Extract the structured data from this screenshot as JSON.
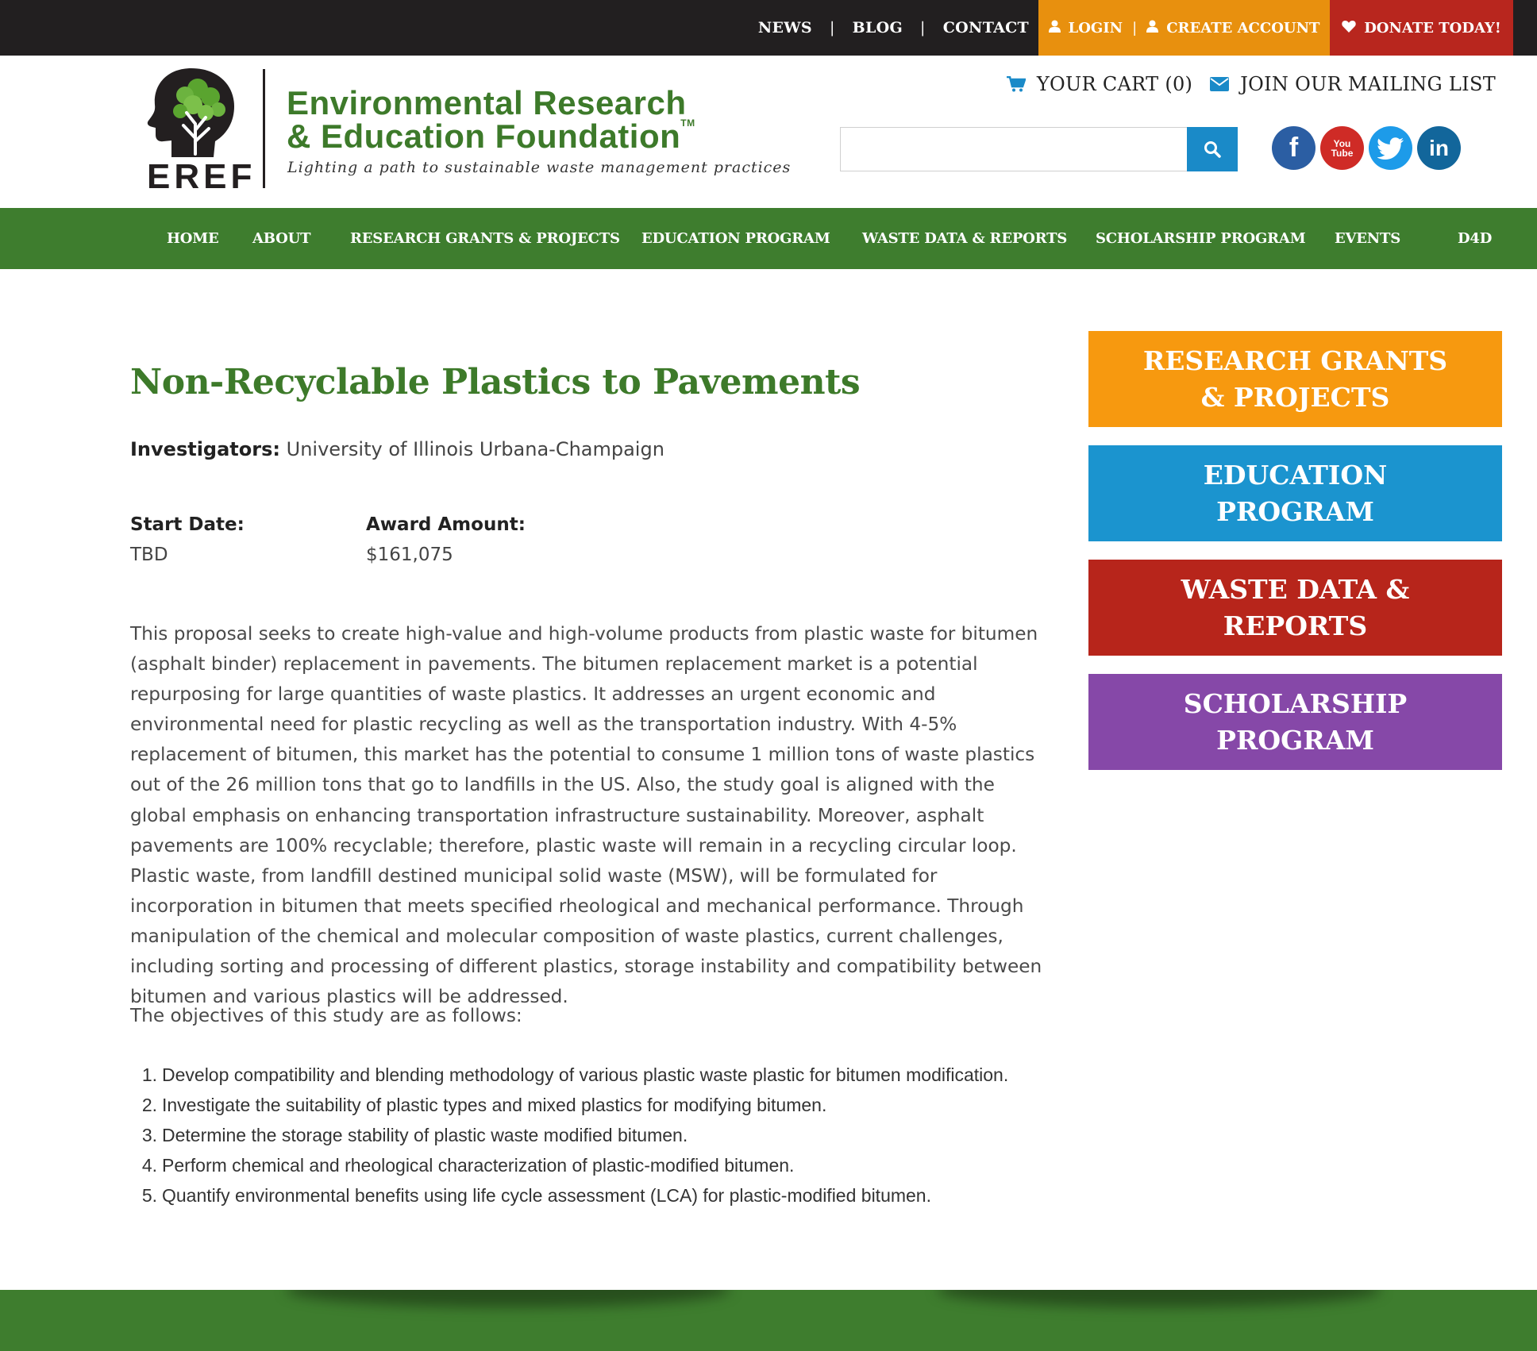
{
  "topbar": {
    "links": [
      "NEWS",
      "BLOG",
      "CONTACT"
    ],
    "separator": "|",
    "login": "LOGIN",
    "create_account": "CREATE ACCOUNT",
    "donate": "DONATE TODAY!",
    "account_color": "#e8900e",
    "donate_color": "#b8261e"
  },
  "logo": {
    "acronym": "EREF",
    "name_line1": "Environmental Research",
    "name_line2": "& Education Foundation",
    "trademark": "TM",
    "tagline": "Lighting a path to sustainable waste management practices"
  },
  "utility": {
    "cart": "YOUR CART (0)",
    "mailing": "JOIN OUR MAILING LIST"
  },
  "search": {
    "value": "",
    "placeholder": ""
  },
  "social": [
    {
      "name": "facebook-icon",
      "glyph": "f"
    },
    {
      "name": "youtube-icon",
      "glyph_top": "You",
      "glyph_bottom": "Tube"
    },
    {
      "name": "twitter-icon"
    },
    {
      "name": "linkedin-icon",
      "glyph": "in"
    }
  ],
  "nav": [
    "HOME",
    "ABOUT",
    "RESEARCH GRANTS & PROJECTS",
    "EDUCATION PROGRAM",
    "WASTE DATA & REPORTS",
    "SCHOLARSHIP PROGRAM",
    "EVENTS",
    "D4D"
  ],
  "page": {
    "title": "Non-Recyclable Plastics to Pavements",
    "investigators_label": "Investigators:",
    "investigators": "University of Illinois Urbana-Champaign",
    "start_label": "Start Date:",
    "start_value": "TBD",
    "award_label": "Award Amount:",
    "award_value": "$161,075",
    "body": "This proposal seeks to create high-value and high-volume products from plastic waste for bitumen (asphalt binder) replacement in pavements. The bitumen replacement market is a potential repurposing for large quantities of waste plastics. It addresses an urgent economic and environmental need for plastic recycling as well as the transportation industry. With 4-5% replacement of bitumen, this market has the potential to consume 1 million tons of waste plastics out of the 26 million tons that go to landfills in the US. Also, the study goal is aligned with the global emphasis on enhancing transportation infrastructure sustainability. Moreover, asphalt pavements are 100% recyclable; therefore, plastic waste will remain in a recycling circular loop. Plastic waste, from landfill destined municipal solid waste (MSW), will be formulated for incorporation in bitumen that meets specified rheological and mechanical performance. Through manipulation of the chemical and molecular composition of waste plastics, current challenges, including sorting and processing of different plastics, storage instability and compatibility between bitumen and various plastics will be addressed.",
    "objectives_intro": "The objectives of this study are as follows:",
    "objectives": [
      {
        "num": "1.",
        "text": "Develop compatibility and blending methodology of various plastic waste plastic for bitumen modification."
      },
      {
        "num": "2.",
        "text": "Investigate the suitability of plastic types and mixed plastics for modifying bitumen."
      },
      {
        "num": "3.",
        "text": "Determine the storage stability of plastic waste modified bitumen."
      },
      {
        "num": "4.",
        "text": "Perform chemical and rheological characterization of plastic-modified bitumen."
      },
      {
        "num": "5.",
        "text": "Quantify environmental benefits using life cycle assessment (LCA) for plastic-modified bitumen."
      }
    ]
  },
  "sidebar": [
    {
      "line1": "RESEARCH GRANTS",
      "line2": "& PROJECTS",
      "color": "#f7990f"
    },
    {
      "line1": "EDUCATION",
      "line2": "PROGRAM",
      "color": "#1b94cf"
    },
    {
      "line1": "WASTE DATA &",
      "line2": "REPORTS",
      "color": "#b7251b"
    },
    {
      "line1": "SCHOLARSHIP",
      "line2": "PROGRAM",
      "color": "#8648a8"
    }
  ],
  "colors": {
    "brand_green": "#3e7d2e",
    "title_green": "#3d7a2a",
    "search_blue": "#1a8ac8",
    "dark_bar": "#221f20"
  }
}
